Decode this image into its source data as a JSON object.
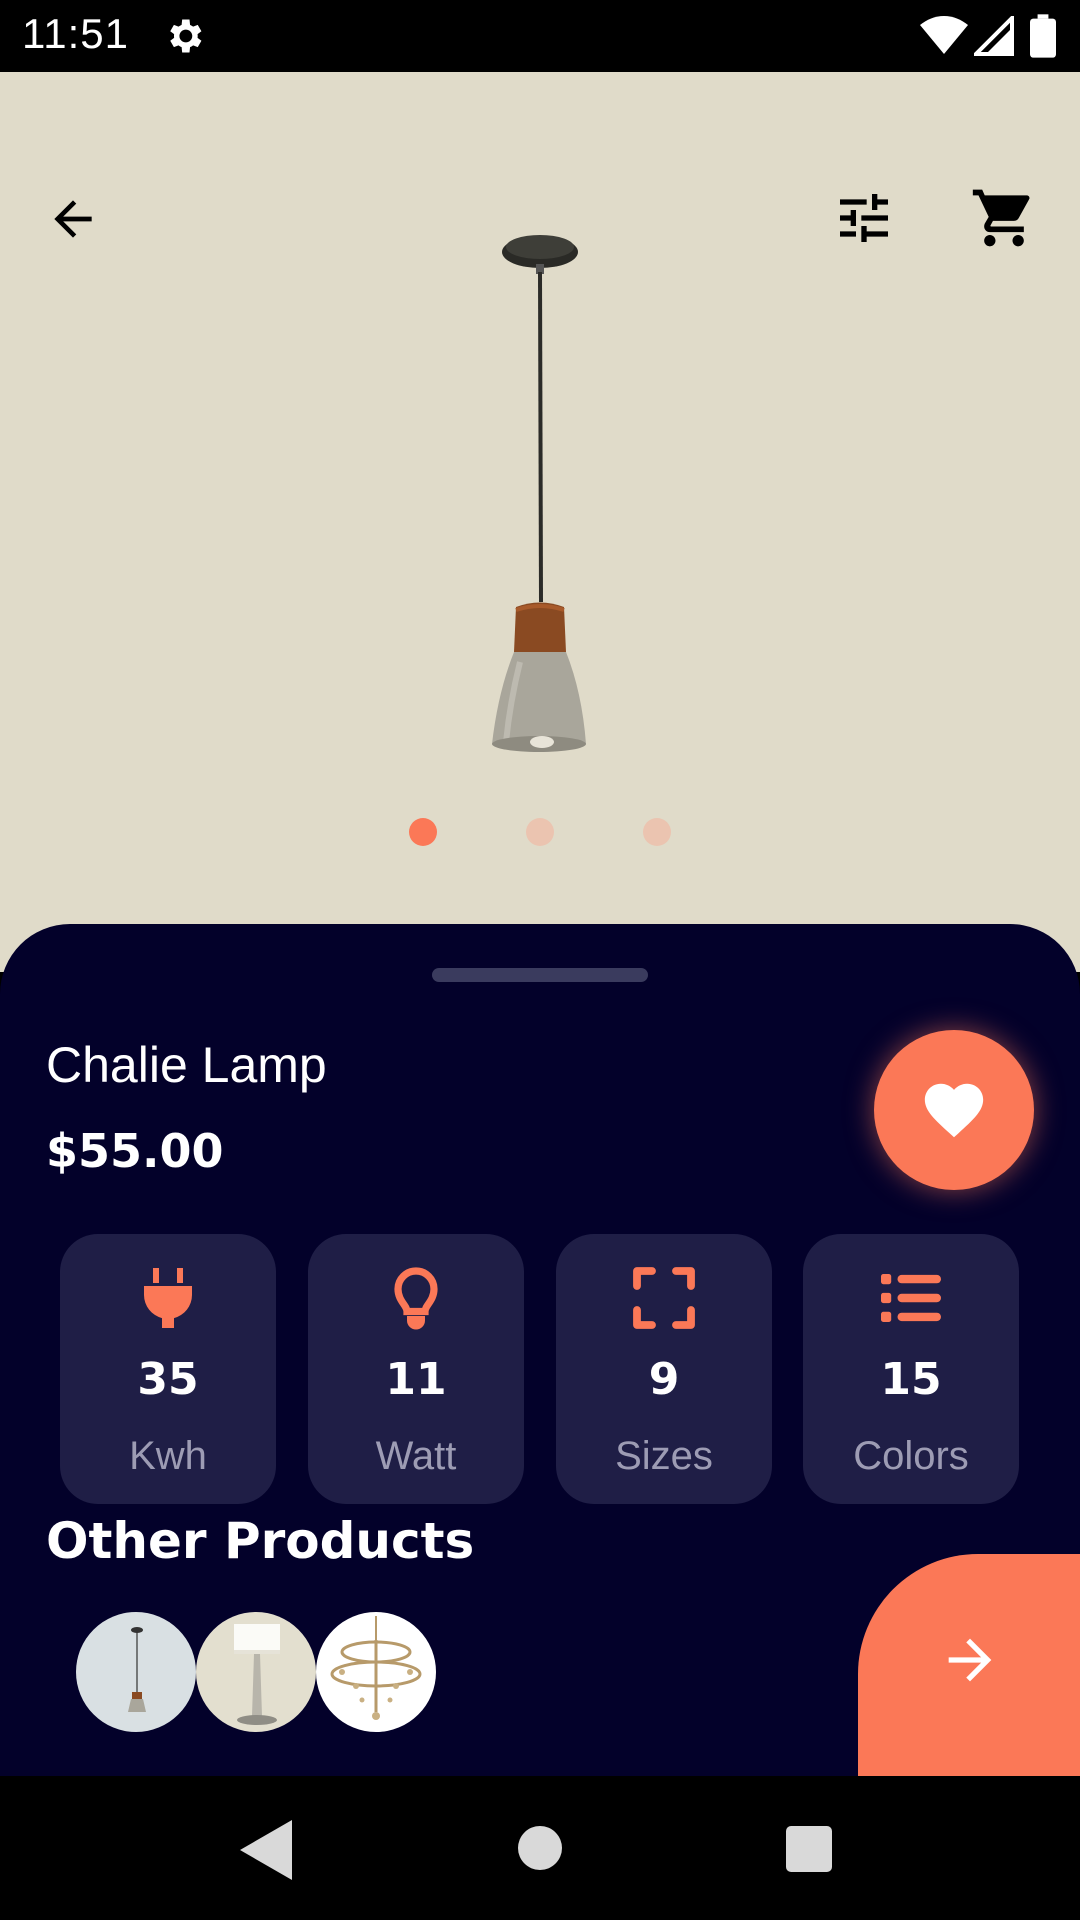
{
  "status_bar": {
    "time": "11:51",
    "icons": [
      "gear-icon",
      "wifi-icon",
      "cellular-signal-icon",
      "battery-icon"
    ]
  },
  "header": {
    "icons": [
      "back-arrow-icon",
      "tune-filter-icon",
      "shopping-cart-icon"
    ]
  },
  "carousel": {
    "page_count": 3,
    "active_index": 0
  },
  "product": {
    "name": "Chalie Lamp",
    "price": "$55.00"
  },
  "specs": [
    {
      "icon": "plug-icon",
      "value": "35",
      "label": "Kwh"
    },
    {
      "icon": "lightbulb-icon",
      "value": "11",
      "label": "Watt"
    },
    {
      "icon": "fullscreen-frame-icon",
      "value": "9",
      "label": "Sizes"
    },
    {
      "icon": "list-icon",
      "value": "15",
      "label": "Colors"
    }
  ],
  "other_products": {
    "title": "Other Products"
  },
  "colors": {
    "accent": "#fb7857",
    "sheet_bg": "#03012a",
    "card_bg": "#1f1e46",
    "hero_bg": "#e0dbc9",
    "muted_text": "#9d9cb4"
  }
}
